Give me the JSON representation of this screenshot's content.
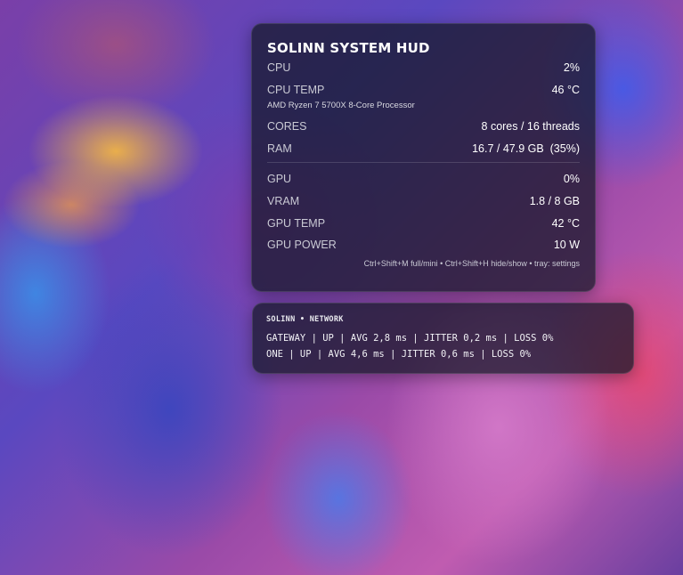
{
  "hud": {
    "title": "SOLINN SYSTEM HUD",
    "cpu": {
      "label": "CPU",
      "value": "2%"
    },
    "cpu_temp": {
      "label": "CPU TEMP",
      "value": "46 °C"
    },
    "cpu_name": "AMD Ryzen 7 5700X 8-Core Processor",
    "cores": {
      "label": "CORES",
      "value": "8 cores / 16 threads"
    },
    "ram": {
      "label": "RAM",
      "value": "16.7 / 47.9 GB  (35%)"
    },
    "gpu": {
      "label": "GPU",
      "value": "0%"
    },
    "vram": {
      "label": "VRAM",
      "value": "1.8 / 8 GB"
    },
    "gpu_temp": {
      "label": "GPU TEMP",
      "value": "42 °C"
    },
    "gpu_power": {
      "label": "GPU POWER",
      "value": "10 W"
    },
    "hint": "Ctrl+Shift+M full/mini • Ctrl+Shift+H hide/show • tray: settings"
  },
  "network": {
    "title": "SOLINN • NETWORK",
    "lines": [
      "GATEWAY | UP | AVG 2,8 ms | JITTER 0,2 ms | LOSS 0%",
      "ONE | UP | AVG 4,6 ms | JITTER 0,6 ms | LOSS 0%"
    ]
  },
  "colors": {
    "panel_bg": "#141826",
    "text": "#ffffff",
    "label": "#c9c9d4"
  }
}
